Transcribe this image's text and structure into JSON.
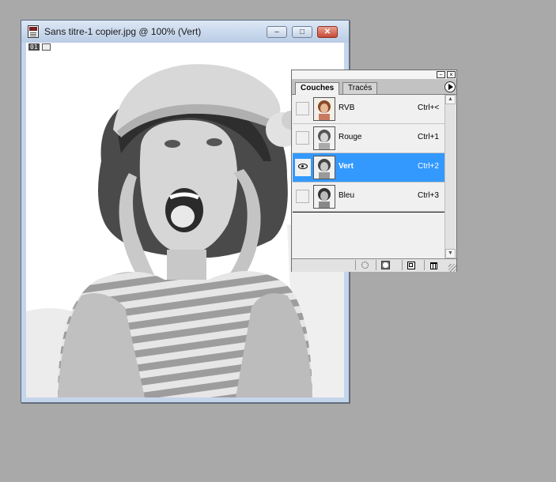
{
  "document_window": {
    "title": "Sans titre-1 copier.jpg @ 100% (Vert)",
    "status_tag": "01",
    "buttons": {
      "minimize": "–",
      "maximize": "□",
      "close": "✕"
    }
  },
  "channels_palette": {
    "tabs": [
      {
        "label": "Couches",
        "active": true
      },
      {
        "label": "Tracés",
        "active": false
      }
    ],
    "channels": [
      {
        "name": "RVB",
        "shortcut": "Ctrl+<",
        "visible": false,
        "selected": false,
        "thumb": "color"
      },
      {
        "name": "Rouge",
        "shortcut": "Ctrl+1",
        "visible": false,
        "selected": false,
        "thumb": "gray"
      },
      {
        "name": "Vert",
        "shortcut": "Ctrl+2",
        "visible": true,
        "selected": true,
        "thumb": "gray"
      },
      {
        "name": "Bleu",
        "shortcut": "Ctrl+3",
        "visible": false,
        "selected": false,
        "thumb": "gray"
      }
    ],
    "bottom_buttons": [
      "load-selection-icon",
      "save-selection-icon",
      "new-channel-icon",
      "trash-icon"
    ]
  },
  "colors": {
    "desktop": "#a9a9a9",
    "selection": "#3399ff"
  }
}
